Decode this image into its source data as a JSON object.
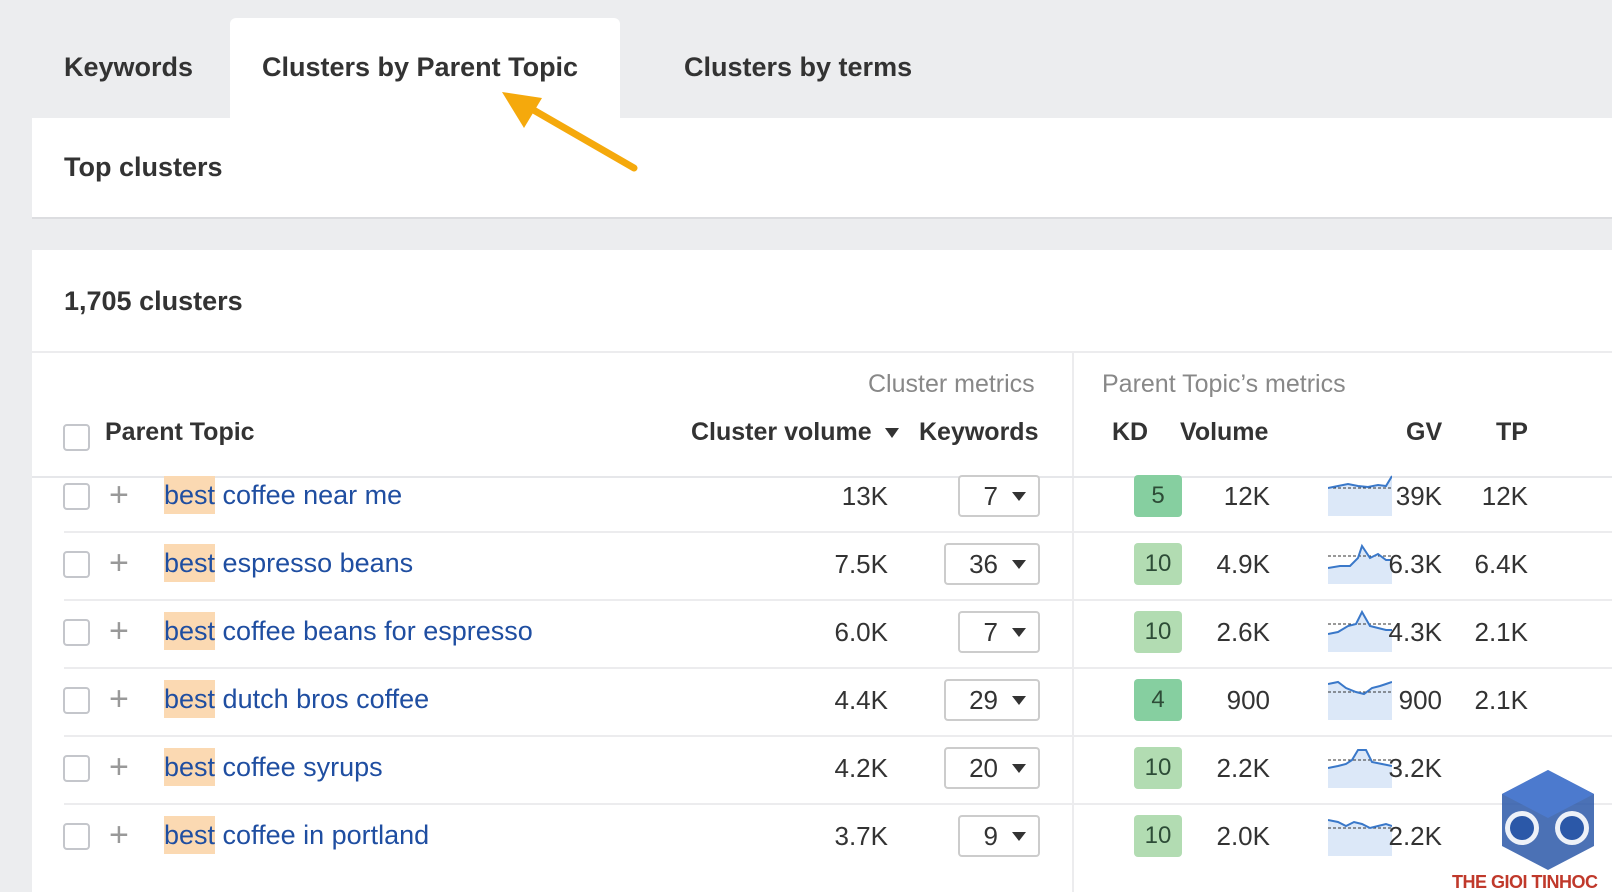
{
  "tabs": [
    {
      "label": "Keywords"
    },
    {
      "label": "Clusters by Parent Topic"
    },
    {
      "label": "Clusters by terms"
    }
  ],
  "top_clusters_title": "Top clusters",
  "cluster_count": "1,705 clusters",
  "table": {
    "group_cluster": "Cluster metrics",
    "group_parent": "Parent Topic’s metrics",
    "col_parent": "Parent Topic",
    "col_cluster_volume": "Cluster volume",
    "col_keywords": "Keywords",
    "col_kd": "KD",
    "col_volume": "Volume",
    "col_gv": "GV",
    "col_tp": "TP",
    "rows": [
      {
        "hl": "best",
        "rest": " coffee near me",
        "cluster_volume": "13K",
        "keywords": "7",
        "kd": "5",
        "volume": "12K",
        "gv": "39K",
        "tp": "12K"
      },
      {
        "hl": "best",
        "rest": " espresso beans",
        "cluster_volume": "7.5K",
        "keywords": "36",
        "kd": "10",
        "volume": "4.9K",
        "gv": "6.3K",
        "tp": "6.4K"
      },
      {
        "hl": "best",
        "rest": " coffee beans for espresso",
        "cluster_volume": "6.0K",
        "keywords": "7",
        "kd": "10",
        "volume": "2.6K",
        "gv": "4.3K",
        "tp": "2.1K"
      },
      {
        "hl": "best",
        "rest": " dutch bros coffee",
        "cluster_volume": "4.4K",
        "keywords": "29",
        "kd": "4",
        "volume": "900",
        "gv": "900",
        "tp": "2.1K"
      },
      {
        "hl": "best",
        "rest": " coffee syrups",
        "cluster_volume": "4.2K",
        "keywords": "20",
        "kd": "10",
        "volume": "2.2K",
        "gv": "3.2K",
        "tp": ""
      },
      {
        "hl": "best",
        "rest": " coffee in portland",
        "cluster_volume": "3.7K",
        "keywords": "9",
        "kd": "10",
        "volume": "2.0K",
        "gv": "2.2K",
        "tp": ""
      }
    ]
  },
  "colors": {
    "link": "#1f4ea1",
    "highlight": "#fbd9b2",
    "kd_low": "#86cfa0",
    "kd_mid": "#b2dcb2",
    "arrow": "#f5a90c"
  },
  "logo_text": "THE GIOI TINHOC"
}
